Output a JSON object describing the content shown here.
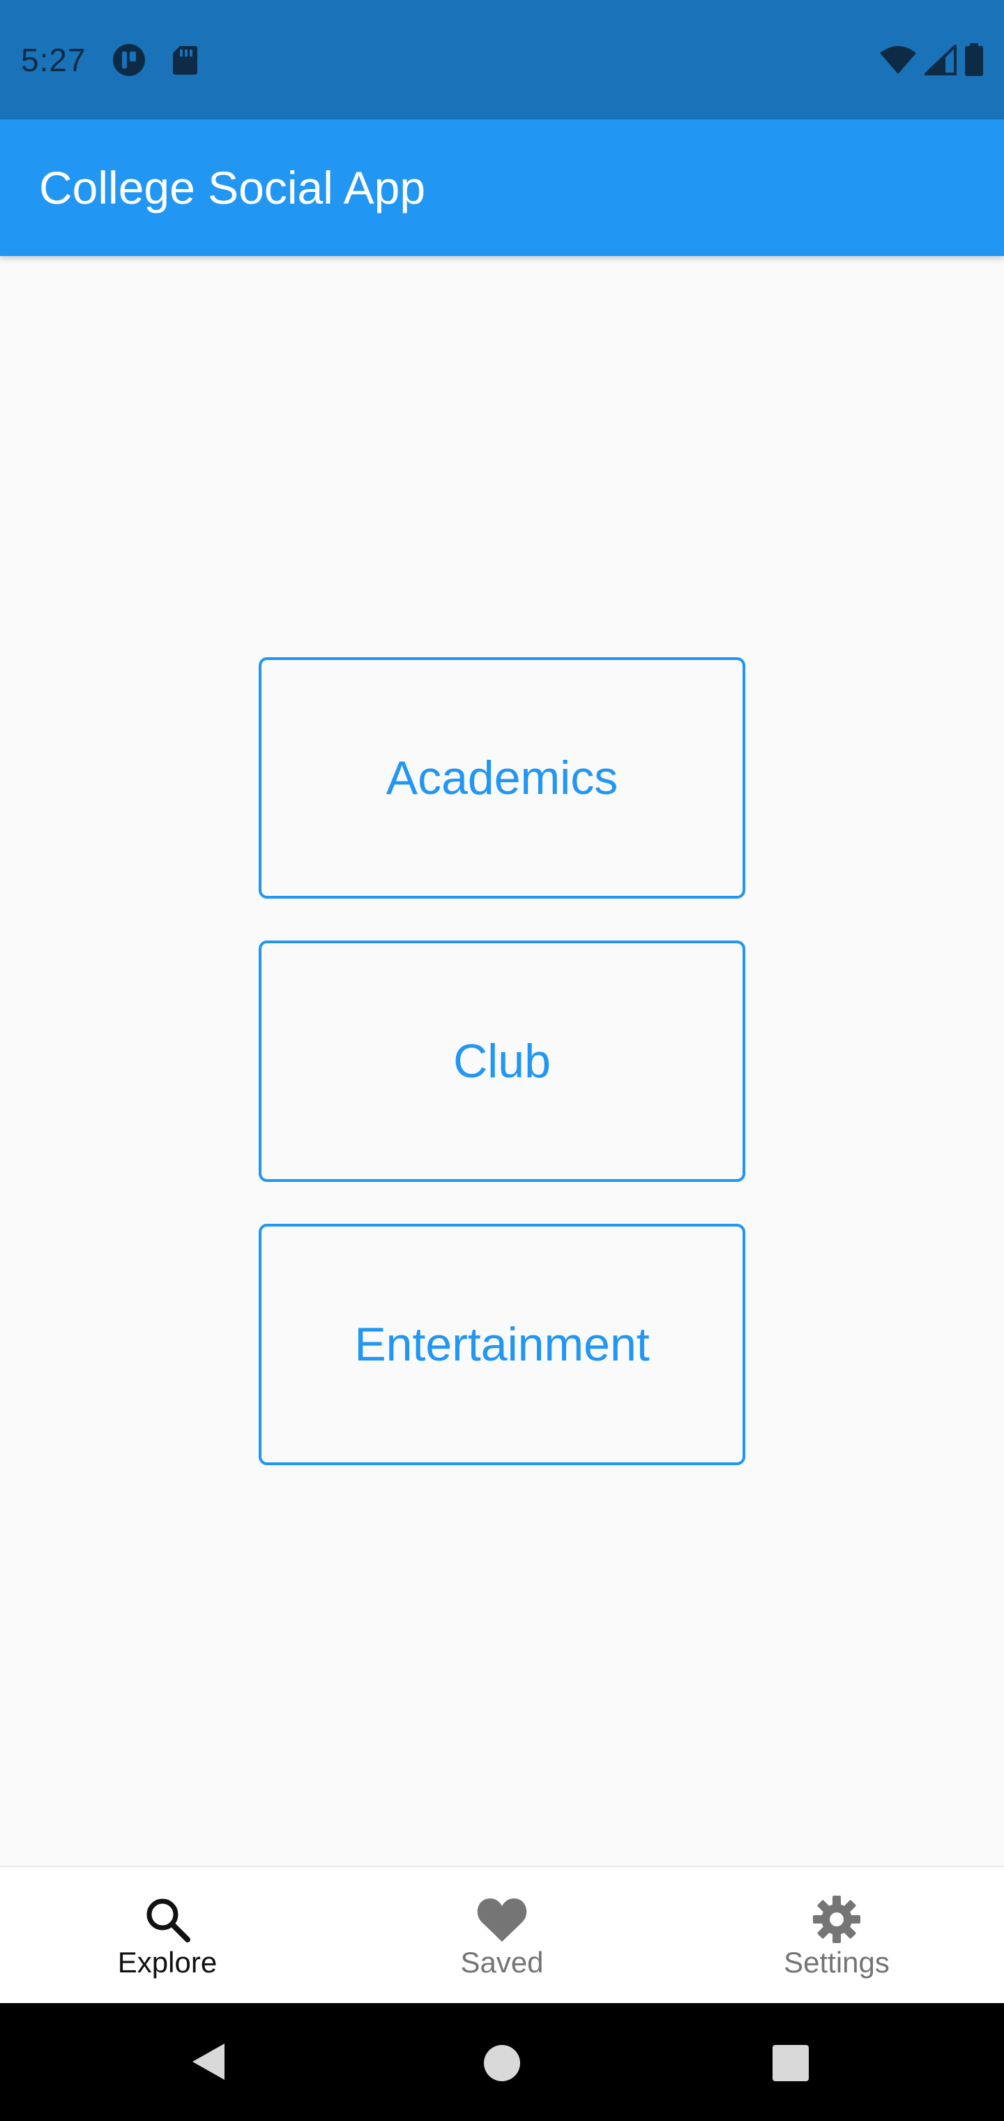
{
  "status_bar": {
    "time": "5:27",
    "left_icons": [
      "app-notification-icon",
      "sd-card-icon"
    ],
    "right_icons": [
      "wifi-icon",
      "cell-signal-icon",
      "battery-icon"
    ]
  },
  "app_bar": {
    "title": "College Social App"
  },
  "categories": [
    {
      "label": "Academics"
    },
    {
      "label": "Club"
    },
    {
      "label": "Entertainment"
    }
  ],
  "bottom_nav": {
    "items": [
      {
        "label": "Explore",
        "icon": "search-icon",
        "active": true
      },
      {
        "label": "Saved",
        "icon": "heart-icon",
        "active": false
      },
      {
        "label": "Settings",
        "icon": "gear-icon",
        "active": false
      }
    ]
  },
  "system_nav": {
    "buttons": [
      "back-icon",
      "home-icon",
      "recents-icon"
    ]
  },
  "colors": {
    "status_bar": "#1a72b9",
    "primary": "#2196f3",
    "background": "#fafafa",
    "nav_active": "#111111",
    "nav_inactive": "#757575"
  }
}
